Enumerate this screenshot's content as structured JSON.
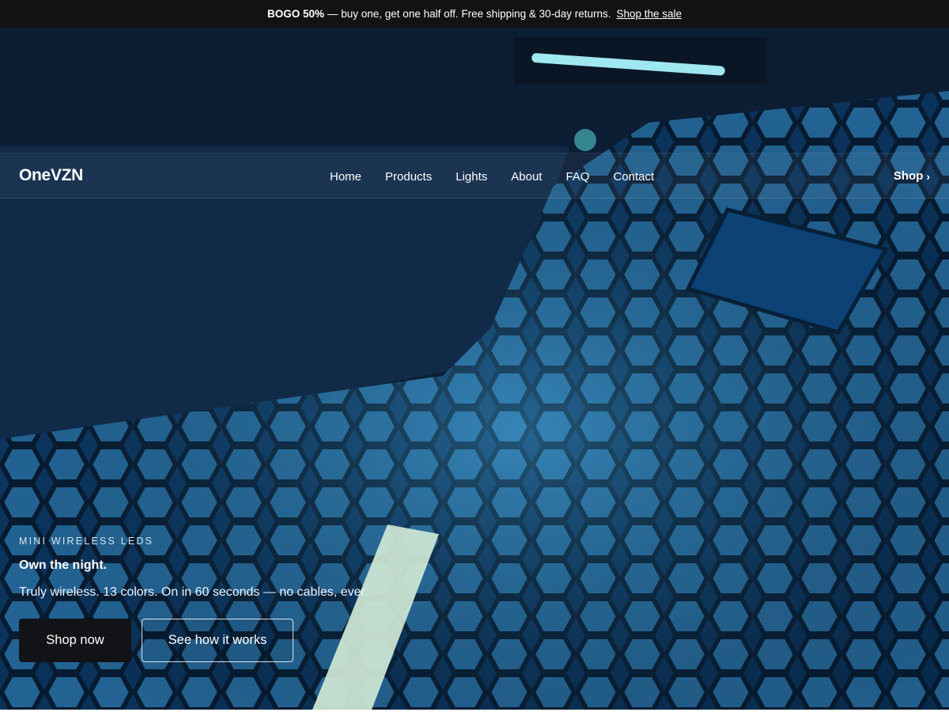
{
  "announcement": {
    "bold": "BOGO 50%",
    "text": "— buy one, get one half off. Free shipping & 30-day returns.",
    "link": "Shop the sale"
  },
  "brand": {
    "name": "OneVZN"
  },
  "nav": {
    "items": [
      "Home",
      "Products",
      "Lights",
      "About",
      "FAQ",
      "Contact"
    ],
    "shop": "Shop",
    "shop_icon": "chevron-right-icon"
  },
  "hero": {
    "eyebrow": "MINI WIRELESS LEDS",
    "headline": "Own the night.",
    "subtext": "Truly wireless. 13 colors. On in 60 seconds — no cables, ever.",
    "primary_cta": "Shop now",
    "secondary_cta": "See how it works"
  },
  "colors": {
    "announcement_bg": "#101214",
    "hero_accent": "#1e8ad0",
    "primary_button": "#111316"
  }
}
